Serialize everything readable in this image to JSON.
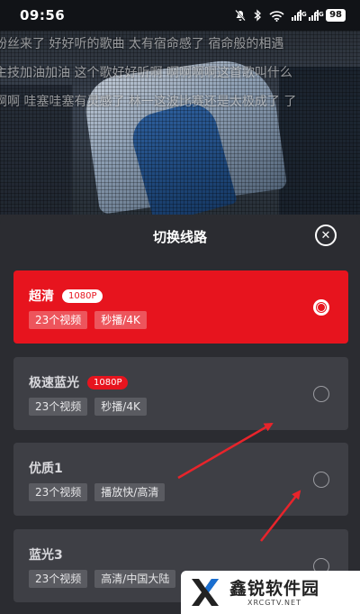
{
  "status_bar": {
    "time": "09:56",
    "network_1": "5G",
    "network_2": "5G",
    "battery": "98",
    "icons": [
      "mute-icon",
      "bluetooth-icon",
      "wifi-icon",
      "signal-icon",
      "signal-icon"
    ]
  },
  "video": {
    "danmaku": [
      "粉丝来了   好好听的歌曲 太有宿命感了 宿命般的相遇",
      "主技加油加油  这个歌好好听啊  啊啊啊啊这首歌叫什么",
      "啊啊 哇塞哇塞有灵感了  林一这波比赛还是太极成了  了"
    ]
  },
  "sheet": {
    "title": "切换线路",
    "close_icon": "close-icon",
    "lines": [
      {
        "name": "超清",
        "badge": "1080P",
        "tags": [
          "23个视频",
          "秒播/4K"
        ],
        "selected": true
      },
      {
        "name": "极速蓝光",
        "badge": "1080P",
        "tags": [
          "23个视频",
          "秒播/4K"
        ],
        "selected": false
      },
      {
        "name": "优质1",
        "badge": "",
        "tags": [
          "23个视频",
          "播放快/高清"
        ],
        "selected": false
      },
      {
        "name": "蓝光3",
        "badge": "",
        "tags": [
          "23个视频",
          "高清/中国大陆"
        ],
        "selected": false
      }
    ]
  },
  "colors": {
    "accent": "#e7141e",
    "sheet_bg": "#2b2c31",
    "card_bg": "#3e3f45",
    "arrow": "#e8242b"
  },
  "watermark": {
    "name": "鑫锐软件园",
    "url": "XRCGTV.NET"
  }
}
